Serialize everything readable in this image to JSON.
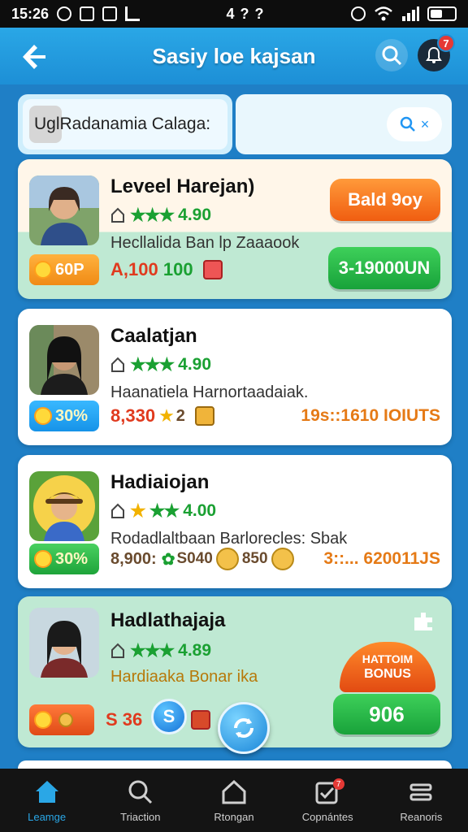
{
  "status_bar": {
    "time": "15:26",
    "center": "4 ? ?"
  },
  "header": {
    "title": "Sasiy loe kajsan",
    "notif_count": "7"
  },
  "search": {
    "left_text": "UglRadanamia Calaga:",
    "clear_label": "×"
  },
  "cards": [
    {
      "name": "Leveel Harejan)",
      "rating": "4.90",
      "description": "Hecllalida Ban lp Zaaaook",
      "badge": "60P",
      "price": "A,100",
      "price_extra": "100",
      "cta_top": "Bald 9oy",
      "cta_bottom": "3-19000UN"
    },
    {
      "name": "Caalatjan",
      "rating": "4.90",
      "description": "Haanatiela Harnortaadaiak.",
      "badge": "30%",
      "price": "8,330",
      "price_extra": "2",
      "right_label": "19s::1610 IOIUTS"
    },
    {
      "name": "Hadiaiojan",
      "rating": "4.00",
      "description": "Rodadlaltbaan Barlorecles: Sbak",
      "badge": "30%",
      "price": "8,900:",
      "price_extra": "S040",
      "price_extra2": "850",
      "right_label": "3::... 620011JS"
    },
    {
      "name": "Hadlathajaja",
      "rating": "4.89",
      "description": "Hardiaaka Bonar ika",
      "price": "S 36",
      "bonus_line1": "HATTOIM",
      "bonus_line2": "BONUS",
      "cta_bottom": "906"
    }
  ],
  "nav": [
    {
      "label": "Leamge"
    },
    {
      "label": "Triaction"
    },
    {
      "label": "Rtongan"
    },
    {
      "label": "Copnántes"
    },
    {
      "label": "Reanoris"
    }
  ],
  "colors": {
    "accent": "#2aa7e6",
    "green": "#1aa032",
    "orange": "#f05d10",
    "background": "#1f7fc6"
  }
}
